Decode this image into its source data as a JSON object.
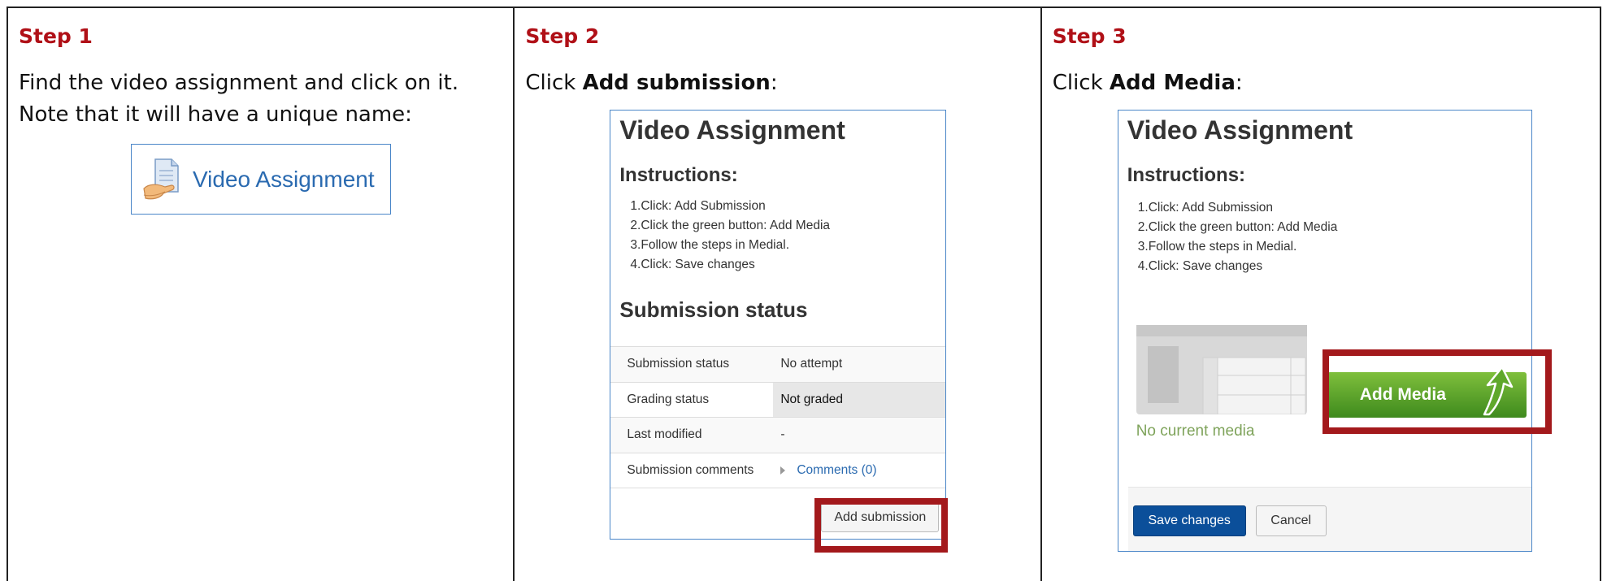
{
  "step1": {
    "title": "Step 1",
    "line1": "Find the video assignment and click on it.",
    "line2": "Note that it will have a unique name:",
    "link_label": "Video Assignment",
    "link_icon": "assignment-doc-icon"
  },
  "step2": {
    "title": "Step 2",
    "instruction_prefix": "Click ",
    "instruction_bold": "Add submission",
    "instruction_suffix": ":",
    "panel": {
      "heading": "Video Assignment",
      "instructions_heading": "Instructions:",
      "instructions": [
        {
          "num": "1.",
          "text": "Click: Add Submission"
        },
        {
          "num": "2.",
          "text": "Click the green button: Add Media"
        },
        {
          "num": "3.",
          "text": "Follow the steps in Medial."
        },
        {
          "num": "4.",
          "text": "Click: Save changes"
        }
      ],
      "status_heading": "Submission status",
      "status_rows": [
        {
          "label": "Submission status",
          "value": "No attempt"
        },
        {
          "label": "Grading status",
          "value": "Not graded"
        },
        {
          "label": "Last modified",
          "value": "-"
        },
        {
          "label": "Submission comments",
          "value": "Comments (0)"
        }
      ],
      "add_submission_label": "Add submission"
    }
  },
  "step3": {
    "title": "Step 3",
    "instruction_prefix": "Click ",
    "instruction_bold": "Add Media",
    "instruction_suffix": ":",
    "panel": {
      "heading": "Video Assignment",
      "instructions_heading": "Instructions:",
      "instructions": [
        {
          "num": "1.",
          "text": "Click: Add Submission"
        },
        {
          "num": "2.",
          "text": "Click the green button: Add Media"
        },
        {
          "num": "3.",
          "text": "Follow the steps in Medial."
        },
        {
          "num": "4.",
          "text": "Click: Save changes"
        }
      ],
      "no_media_text": "No current media",
      "add_media_label": "Add Media",
      "save_label": "Save changes",
      "cancel_label": "Cancel"
    }
  },
  "colors": {
    "step_title": "#b01017",
    "highlight": "#a3191c",
    "link": "#2a6ab0",
    "save_button": "#0b4f9a",
    "add_media_green": "#4f9b27"
  }
}
